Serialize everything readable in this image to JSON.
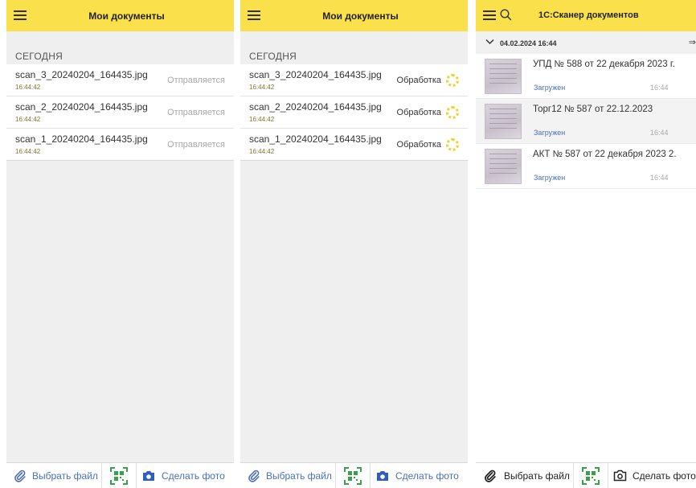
{
  "panels": [
    {
      "title": "Мои документы",
      "section": "СЕГОДНЯ",
      "rows": [
        {
          "name": "scan_3_20240204_164435.jpg",
          "time": "16:44:42",
          "status": "Отправляется"
        },
        {
          "name": "scan_2_20240204_164435.jpg",
          "time": "16:44:42",
          "status": "Отправляется"
        },
        {
          "name": "scan_1_20240204_164435.jpg",
          "time": "16:44:42",
          "status": "Отправляется"
        }
      ],
      "bottom": {
        "file_label": "Выбрать файл",
        "photo_label": "Сделать фото"
      }
    },
    {
      "title": "Мои документы",
      "section": "СЕГОДНЯ",
      "rows": [
        {
          "name": "scan_3_20240204_164435.jpg",
          "time": "16:44:42",
          "status": "Обработка"
        },
        {
          "name": "scan_2_20240204_164435.jpg",
          "time": "16:44:42",
          "status": "Обработка"
        },
        {
          "name": "scan_1_20240204_164435.jpg",
          "time": "16:44:42",
          "status": "Обработка"
        }
      ],
      "bottom": {
        "file_label": "Выбрать файл",
        "photo_label": "Сделать фото"
      }
    }
  ],
  "scanner": {
    "title": "1С:Сканер документов",
    "date": "04.02.2024 16:44",
    "docs": [
      {
        "title": "УПД № 588 от 22 декабря 2023 г.",
        "status": "Загружен",
        "time": "16:44"
      },
      {
        "title": "Торг12 № 587 от 22.12.2023",
        "status": "Загружен",
        "time": "16:44"
      },
      {
        "title": "АКТ № 587 от 22 декабря 2023 2.",
        "status": "Загружен",
        "time": "16:44"
      }
    ],
    "bottom": {
      "file_label": "Выбрать файл",
      "photo_label": "Сделать фото"
    }
  },
  "colors": {
    "header": "#fae14b",
    "accent": "#4a6fb5",
    "qr": "#3aa04a",
    "spinner": "#f3cf2a"
  },
  "icons": [
    "menu-icon",
    "search-icon",
    "paperclip-icon",
    "qr-code-icon",
    "camera-icon",
    "chevron-down-icon",
    "export-icon",
    "spinner-icon"
  ]
}
